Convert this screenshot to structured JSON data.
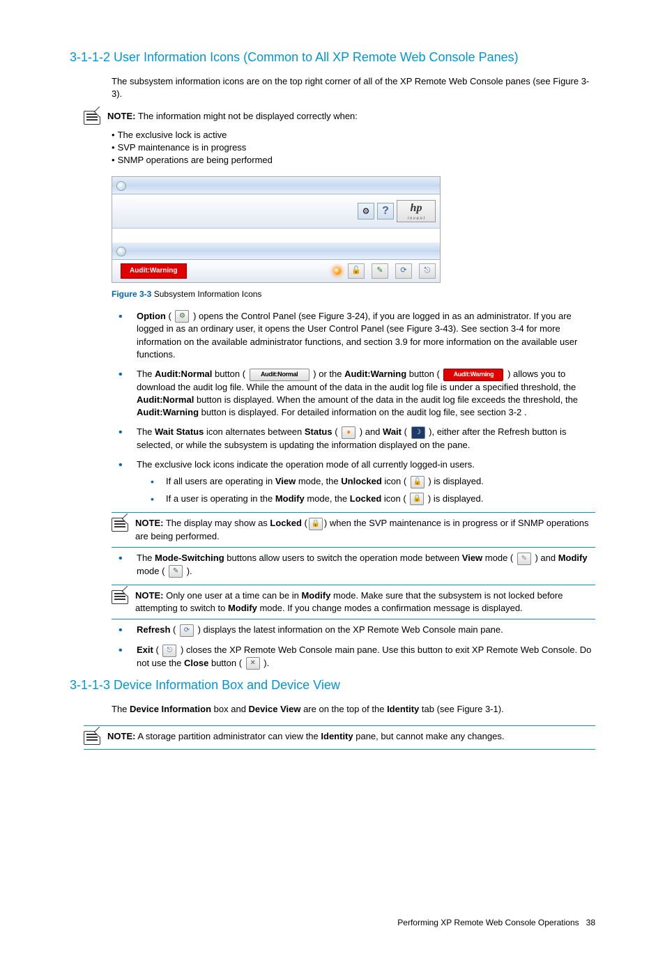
{
  "section1": {
    "heading": "3-1-1-2 User Information Icons (Common to All XP Remote Web Console Panes)",
    "intro": "The subsystem information icons are on the top right corner of all of the XP Remote Web Console panes (see Figure 3-3).",
    "note_label": "NOTE:",
    "note_text": "The information might not be displayed correctly when:",
    "note_items": [
      "The exclusive lock is active",
      "SVP maintenance is in progress",
      "SNMP operations are being performed"
    ]
  },
  "figure": {
    "audit_warning_btn": "Audit:Warning",
    "hp_invent": "i n v e n t",
    "caption_label": "Figure 3-3",
    "caption_text": " Subsystem Information Icons"
  },
  "bullets": {
    "option_bold": "Option",
    "option_text1": " ( ",
    "option_text2": " ) opens the Control Panel (see Figure 3-24), if you are logged in as an administrator. If you are logged in as an ordinary user, it opens the User Control Panel (see Figure 3-43). See section 3-4 for more information on the available administrator functions, and section 3.9 for more information on the available user functions.",
    "audit_pre": "The ",
    "audit_normal_bold": "Audit:Normal",
    "audit_mid1": " button ( ",
    "audit_mid2": " ) or the ",
    "audit_warning_bold": "Audit:Warning",
    "audit_mid3": " button ( ",
    "audit_post": " ) allows you to download the audit log file. While the amount of the data in the audit log file is under a specified threshold, the ",
    "audit_post2": " button is displayed. When the amount of the data in the audit log file exceeds the threshold, the ",
    "audit_post3": " button is displayed. For detailed information on the audit log file, see section 3-2 .",
    "auditnormal_icon_label": "Audit:Normal",
    "auditwarning_icon_label": "Audit:Warning",
    "wait_pre": "The ",
    "wait_bold": "Wait Status",
    "wait_mid1": " icon alternates between ",
    "status_bold": "Status",
    "wait_mid2": " ( ",
    "wait_mid3": " ) and ",
    "wait_bold2": "Wait",
    "wait_mid4": " ( ",
    "wait_post": " ), either after the Refresh button is selected, or while the subsystem is updating the information displayed on the pane.",
    "lock_intro": "The exclusive lock icons indicate the operation mode of all currently logged-in users.",
    "lock_sub1_pre": "If all users are operating in ",
    "view_bold": "View",
    "lock_sub1_mid": " mode, the ",
    "unlocked_bold": "Unlocked",
    "lock_sub1_post": " icon ( ",
    "lock_sub1_end": " ) is displayed.",
    "lock_sub2_pre": "If a user is operating in the ",
    "modify_bold": "Modify",
    "lock_sub2_mid": " mode, the ",
    "locked_bold": "Locked",
    "lock_sub2_post": " icon ( ",
    "lock_sub2_end": " ) is displayed.",
    "modesw_pre": "The ",
    "modesw_bold": "Mode-Switching",
    "modesw_mid1": " buttons allow users to switch the operation mode between ",
    "modesw_mid2": " mode ( ",
    "modesw_mid3": " ) and ",
    "modesw_mid4": " mode ( ",
    "modesw_end": " ).",
    "refresh_bold": "Refresh",
    "refresh_text": " ( ",
    "refresh_post": " ) displays the latest information on the XP Remote Web Console main pane.",
    "exit_bold": "Exit",
    "exit_text": " ( ",
    "exit_mid": " ) closes the XP Remote Web Console main pane. Use this button to exit XP Remote Web Console. Do not use the ",
    "close_bold": "Close",
    "exit_post": " button ( ",
    "exit_end": " )."
  },
  "note2": {
    "label": "NOTE:",
    "pre": "The display may show as ",
    "locked_bold": "Locked",
    "mid": " (",
    "post": ") when the SVP maintenance is in progress or if SNMP operations are being performed."
  },
  "note3": {
    "label": "NOTE:",
    "pre": "Only one user at a time can be in ",
    "modify_bold": "Modify",
    "mid": " mode. Make sure that the subsystem is not locked before attempting to switch to ",
    "post": " mode. If you change modes a confirmation message is displayed."
  },
  "section2": {
    "heading": "3-1-1-3 Device Information Box and Device View",
    "intro_pre": "The ",
    "di_bold": "Device Information",
    "intro_mid1": " box and ",
    "dv_bold": "Device View",
    "intro_mid2": " are on the top of the ",
    "identity_bold": "Identity",
    "intro_post": " tab (see Figure 3-1).",
    "note_label": "NOTE:",
    "note_pre": "A storage partition administrator can view the ",
    "note_post": " pane, but cannot make any changes."
  },
  "footer": {
    "text": "Performing XP Remote Web Console Operations",
    "page": "38"
  }
}
